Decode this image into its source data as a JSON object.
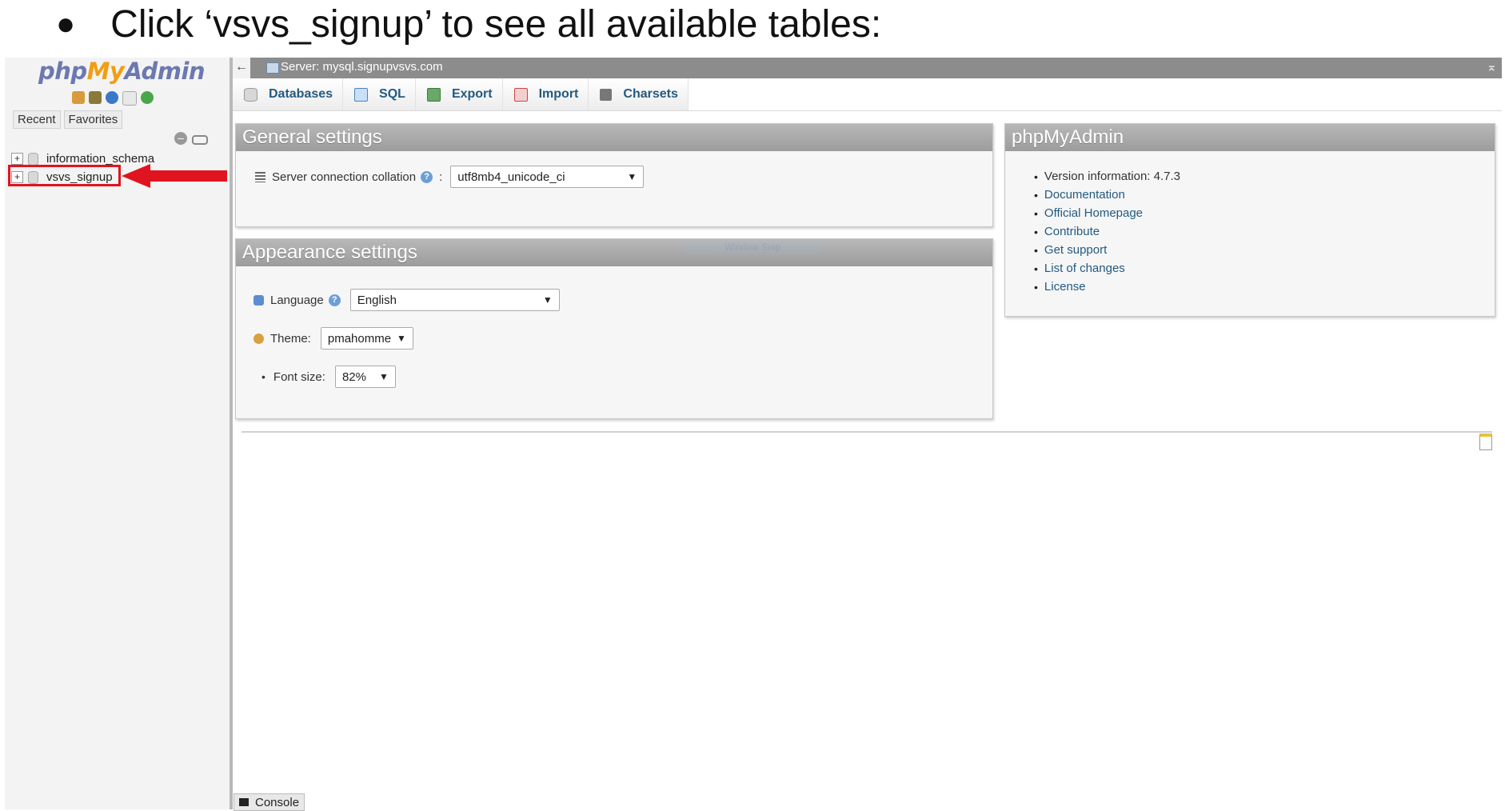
{
  "instruction": {
    "bullet": "●",
    "text": "Click ‘vsvs_signup’ to see all available tables:"
  },
  "nav": {
    "logo": {
      "php": "php",
      "my": "My",
      "admin": "Admin"
    },
    "tabs": [
      "Recent",
      "Favorites"
    ],
    "databases": [
      {
        "name": "information_schema"
      },
      {
        "name": "vsvs_signup"
      }
    ]
  },
  "topbar": {
    "server_label": "Server: mysql.signupvsvs.com",
    "back": "←",
    "up": "⌅"
  },
  "menu": [
    {
      "label": "Databases",
      "icon": "database-icon"
    },
    {
      "label": "SQL",
      "icon": "sql-icon"
    },
    {
      "label": "Export",
      "icon": "export-icon"
    },
    {
      "label": "Import",
      "icon": "import-icon"
    },
    {
      "label": "Charsets",
      "icon": "charsets-icon"
    }
  ],
  "general": {
    "title": "General settings",
    "collation_label": "Server connection collation",
    "colon": ":",
    "collation_value": "utf8mb4_unicode_ci"
  },
  "appearance": {
    "title": "Appearance settings",
    "language_label": "Language",
    "language_value": "English",
    "theme_label": "Theme:",
    "theme_value": "pmahomme",
    "fontsize_label": "Font size:",
    "fontsize_value": "82%"
  },
  "pma_panel": {
    "title": "phpMyAdmin",
    "version": "Version information: 4.7.3",
    "links": [
      "Documentation",
      "Official Homepage",
      "Contribute",
      "Get support",
      "List of changes",
      "License"
    ]
  },
  "console": {
    "label": "Console"
  },
  "watermark": "Window Snip",
  "colors": {
    "highlight": "#e0141e",
    "link": "#235a81",
    "panel_head": "#a8a8a8"
  }
}
